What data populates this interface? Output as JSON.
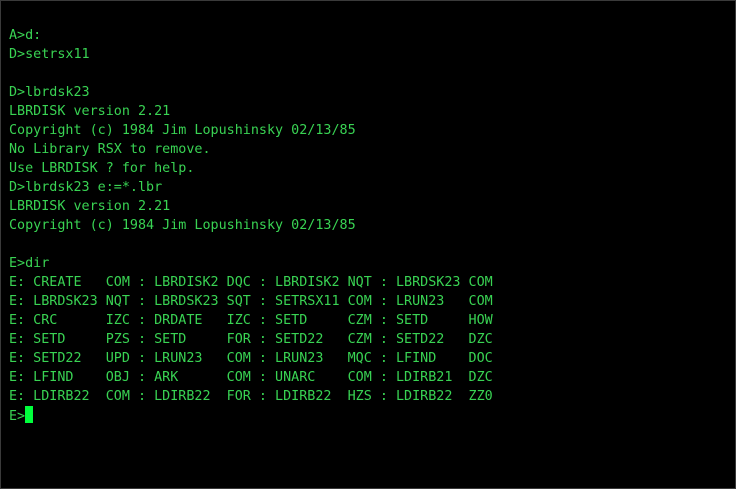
{
  "terminal": {
    "lines": [
      "A>d:",
      "D>setrsx11",
      "",
      "D>lbrdsk23",
      "LBRDISK version 2.21",
      "Copyright (c) 1984 Jim Lopushinsky 02/13/85",
      "No Library RSX to remove.",
      "Use LBRDISK ? for help.",
      "D>lbrdsk23 e:=*.lbr",
      "LBRDISK version 2.21",
      "Copyright (c) 1984 Jim Lopushinsky 02/13/85",
      "",
      "E>dir",
      "E: CREATE   COM : LBRDISK2 DQC : LBRDISK2 NQT : LBRDSK23 COM",
      "E: LBRDSK23 NQT : LBRDSK23 SQT : SETRSX11 COM : LRUN23   COM",
      "E: CRC      IZC : DRDATE   IZC : SETD     CZM : SETD     HOW",
      "E: SETD     PZS : SETD     FOR : SETD22   CZM : SETD22   DZC",
      "E: SETD22   UPD : LRUN23   COM : LRUN23   MQC : LFIND    DOC",
      "E: LFIND    OBJ : ARK      COM : UNARC    COM : LDIRB21  DZC",
      "E: LDIRB22  COM : LDIRB22  FOR : LDIRB22  HZS : LDIRB22  ZZ0"
    ],
    "prompt": "E>",
    "colors": {
      "background": "#000000",
      "text": "#39d353",
      "cursor": "#00ff3c"
    }
  }
}
